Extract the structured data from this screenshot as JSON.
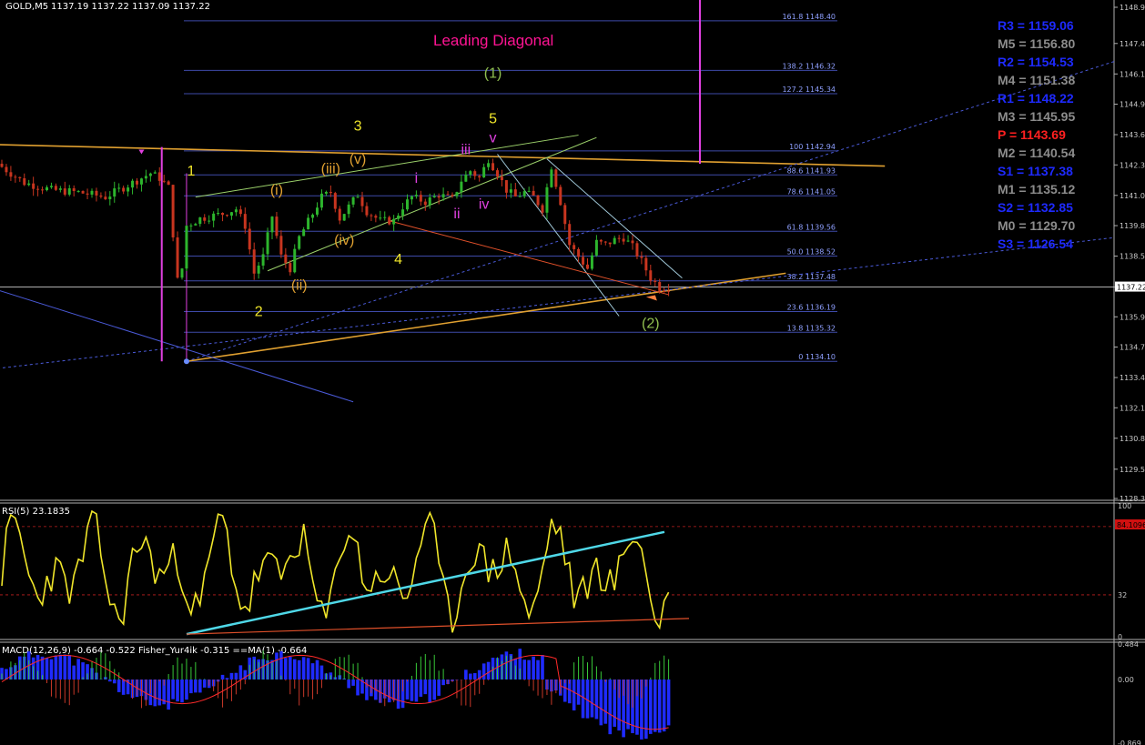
{
  "header": {
    "symbol": "GOLD,M5",
    "ohlc": "1137.19 1137.22 1137.09 1137.22"
  },
  "title": "Leading Diagonal",
  "colors": {
    "background": "#000000",
    "grid": "#1a1a1a",
    "bull": "#2db52d",
    "bear": "#c8351f",
    "fib": "#3e4aa8",
    "gann": "#e0a030",
    "magenta": "#e040e0",
    "rsi": "#f0e62a",
    "trend_cyan": "#4fd8e8",
    "trend_red": "#e0502a",
    "macd_hist": "#1f2bff",
    "signal": "#ff2a2a",
    "fisher_green": "#38c838",
    "fisher_red": "#c83828"
  },
  "chart_data": [
    {
      "type": "candlestick",
      "panel": "price",
      "ylim": [
        1128.34,
        1148.97
      ],
      "price_ticks": [
        "1148.97",
        "1147.45",
        "1146.17",
        "1144.90",
        "1143.62",
        "1142.35",
        "1141.07",
        "1139.80",
        "1138.52",
        "1137.22",
        "1135.97",
        "1134.70",
        "1133.42",
        "1132.15",
        "1130.87",
        "1129.57",
        "1128.34"
      ],
      "current_price": "1137.22",
      "fib_levels": [
        {
          "label": "161.8 1148.40",
          "price": 1148.4
        },
        {
          "label": "138.2 1146.32",
          "price": 1146.32
        },
        {
          "label": "127.2 1145.34",
          "price": 1145.34
        },
        {
          "label": "100 1142.94",
          "price": 1142.94
        },
        {
          "label": "88.6 1141.93",
          "price": 1141.93
        },
        {
          "label": "78.6 1141.05",
          "price": 1141.05
        },
        {
          "label": "61.8 1139.56",
          "price": 1139.56
        },
        {
          "label": "50.0 1138.52",
          "price": 1138.52
        },
        {
          "label": "38.2 1137.48",
          "price": 1137.48
        },
        {
          "label": "23.6 1136.19",
          "price": 1136.19
        },
        {
          "label": "13.8 1135.32",
          "price": 1135.32
        },
        {
          "label": "0 1134.10",
          "price": 1134.1
        }
      ],
      "pivots": [
        {
          "label": "R3 = 1159.06",
          "color": "#1e2aff"
        },
        {
          "label": "M5 = 1156.80",
          "color": "#8c8c8c"
        },
        {
          "label": "R2 = 1154.53",
          "color": "#1e2aff"
        },
        {
          "label": "M4 = 1151.38",
          "color": "#8c8c8c"
        },
        {
          "label": "R1 = 1148.22",
          "color": "#1e2aff"
        },
        {
          "label": "M3 = 1145.95",
          "color": "#8c8c8c"
        },
        {
          "label": "P   = 1143.69",
          "color": "#ff2020"
        },
        {
          "label": "M2 = 1140.54",
          "color": "#8c8c8c"
        },
        {
          "label": "S1 = 1137.38",
          "color": "#1e2aff"
        },
        {
          "label": "M1 = 1135.12",
          "color": "#8c8c8c"
        },
        {
          "label": "S2 = 1132.85",
          "color": "#1e2aff"
        },
        {
          "label": "M0 = 1129.70",
          "color": "#8c8c8c"
        },
        {
          "label": "S3 = 1126.54",
          "color": "#1e2aff"
        }
      ],
      "wave_labels": [
        {
          "text": "(1)",
          "price": 1146.0,
          "bar": 109,
          "color": "#90c050"
        },
        {
          "text": "5",
          "price": 1144.1,
          "bar": 109,
          "color": "#f0e62a"
        },
        {
          "text": "v",
          "price": 1143.3,
          "bar": 109,
          "color": "#e040e0"
        },
        {
          "text": "3",
          "price": 1143.8,
          "bar": 79,
          "color": "#f0e62a"
        },
        {
          "text": "(v)",
          "price": 1142.4,
          "bar": 79,
          "color": "#e0a030"
        },
        {
          "text": "(iii)",
          "price": 1142.0,
          "bar": 73,
          "color": "#e0a030"
        },
        {
          "text": "iii",
          "price": 1142.8,
          "bar": 103,
          "color": "#e040e0"
        },
        {
          "text": "1",
          "price": 1141.9,
          "bar": 42,
          "color": "#f0e62a"
        },
        {
          "text": "(i)",
          "price": 1141.1,
          "bar": 61,
          "color": "#e0a030"
        },
        {
          "text": "i",
          "price": 1141.6,
          "bar": 92,
          "color": "#e040e0"
        },
        {
          "text": "ii",
          "price": 1140.1,
          "bar": 101,
          "color": "#e040e0"
        },
        {
          "text": "iv",
          "price": 1140.5,
          "bar": 107,
          "color": "#e040e0"
        },
        {
          "text": "(iv)",
          "price": 1139.0,
          "bar": 76,
          "color": "#e0a030"
        },
        {
          "text": "4",
          "price": 1138.2,
          "bar": 88,
          "color": "#f0e62a"
        },
        {
          "text": "(ii)",
          "price": 1137.1,
          "bar": 66,
          "color": "#e0a030"
        },
        {
          "text": "2",
          "price": 1136.0,
          "bar": 57,
          "color": "#f0e62a"
        },
        {
          "text": "(2)",
          "price": 1135.5,
          "bar": 144,
          "color": "#90c050"
        }
      ],
      "candles_note": "M5 candles, about 149 bars"
    },
    {
      "type": "line",
      "panel": "rsi",
      "name": "RSI(5) 23.1835",
      "ylim": [
        0,
        100
      ],
      "ticks": [
        "100",
        "32",
        "0"
      ],
      "current_label": "84.1096",
      "levels": [
        84.1,
        32
      ]
    },
    {
      "type": "bar",
      "panel": "macd",
      "name": "MACD(12,26,9) -0.664 -0.522  Fisher_Yur4ik -0.315  ==MA(1) -0.664",
      "ylim": [
        -0.869,
        0.484
      ],
      "ticks": [
        "0.484",
        "0.00",
        "-0.869"
      ]
    }
  ]
}
